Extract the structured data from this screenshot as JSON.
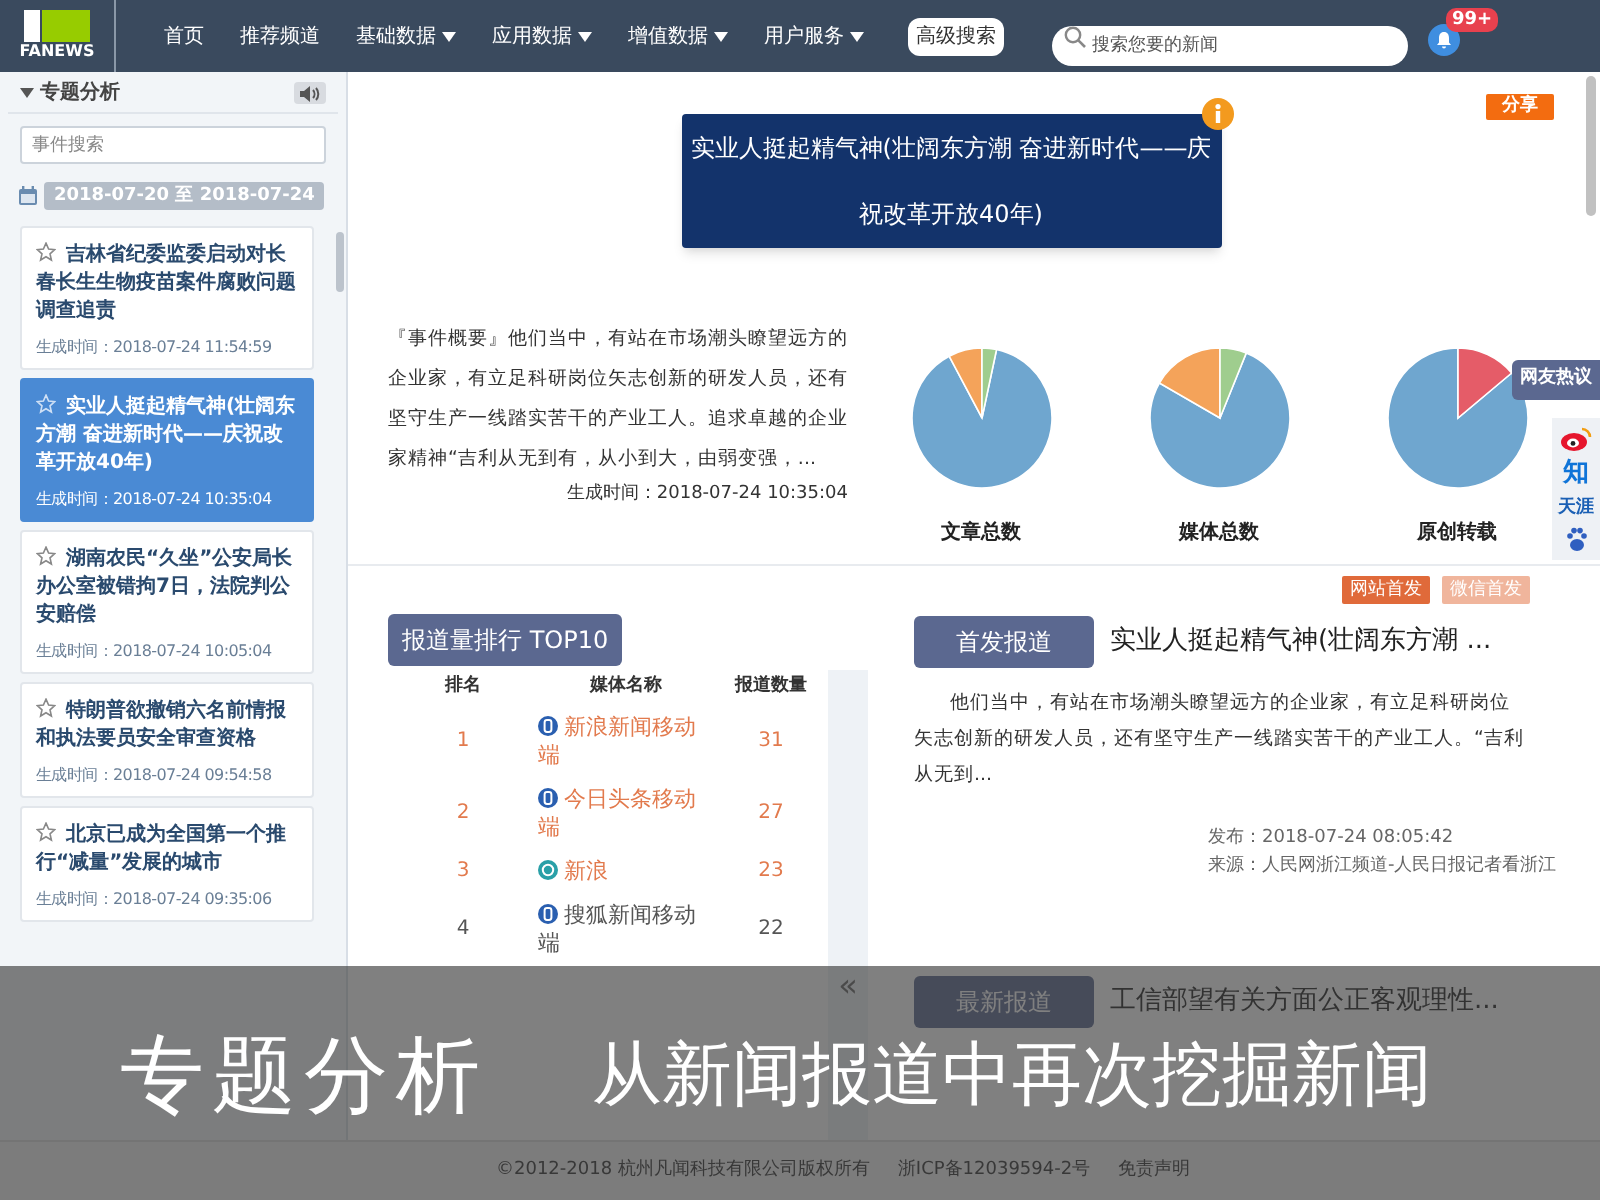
{
  "header": {
    "logo_text": "FANEWS",
    "nav": [
      {
        "label": "首页",
        "dropdown": false
      },
      {
        "label": "推荐频道",
        "dropdown": false
      },
      {
        "label": "基础数据",
        "dropdown": true
      },
      {
        "label": "应用数据",
        "dropdown": true
      },
      {
        "label": "增值数据",
        "dropdown": true
      },
      {
        "label": "用户服务",
        "dropdown": true
      }
    ],
    "advanced_search": "高级搜索",
    "search": {
      "placeholder": "搜索您要的新闻"
    },
    "notifications_badge": "99+"
  },
  "sidebar": {
    "title": "专题分析",
    "search": {
      "placeholder": "事件搜索"
    },
    "date_range": "2018-07-20 至 2018-07-24",
    "items": [
      {
        "title": "吉林省纪委监委启动对长春长生生物疫苗案件腐败问题调查追责",
        "time": "生成时间：2018-07-24 11:54:59",
        "selected": false
      },
      {
        "title": "实业人挺起精气神(壮阔东方潮 奋进新时代——庆祝改革开放40年)",
        "time": "生成时间：2018-07-24 10:35:04",
        "selected": true
      },
      {
        "title": "湖南农民“久坐”公安局长办公室被错拘7日，法院判公安赔偿",
        "time": "生成时间：2018-07-24 10:05:04",
        "selected": false
      },
      {
        "title": "特朗普欲撤销六名前情报和执法要员安全审查资格",
        "time": "生成时间：2018-07-24 09:54:58",
        "selected": false
      },
      {
        "title": "北京已成为全国第一个推行“减量”发展的城市",
        "time": "生成时间：2018-07-24 09:35:06",
        "selected": false
      }
    ]
  },
  "topic": {
    "title": "实业人挺起精气神(壮阔东方潮 奋进新时代——庆祝改革开放40年)",
    "share": "分享",
    "summary": "『事件概要』他们当中，有站在市场潮头瞭望远方的企业家，有立足科研岗位矢志创新的研发人员，还有坚守生产一线踏实苦干的产业工人。追求卓越的企业家精神“吉利从无到有，从小到大，由弱变强，...",
    "time": "生成时间：2018-07-24 10:35:04",
    "charts": [
      {
        "label": "文章总数"
      },
      {
        "label": "媒体总数"
      },
      {
        "label": "原创转载"
      }
    ]
  },
  "side_links": {
    "hot": "网友热议",
    "zhihu": "知",
    "tianya": "天涯"
  },
  "ranking": {
    "title": "报道量排行 TOP10",
    "columns": [
      "排名",
      "媒体名称",
      "报道数量"
    ],
    "rows": [
      {
        "rank": "1",
        "media": "新浪新闻移动端",
        "count": "31",
        "kind": "app",
        "highlighted": true
      },
      {
        "rank": "2",
        "media": "今日头条移动端",
        "count": "27",
        "kind": "app",
        "highlighted": true
      },
      {
        "rank": "3",
        "media": "新浪",
        "count": "23",
        "kind": "web",
        "highlighted": true
      },
      {
        "rank": "4",
        "media": "搜狐新闻移动端",
        "count": "22",
        "kind": "app",
        "highlighted": false
      }
    ],
    "collapse": "«"
  },
  "first_report": {
    "filters": [
      {
        "label": "网站首发",
        "selected": true
      },
      {
        "label": "微信首发",
        "selected": false
      }
    ],
    "tab": "首发报道",
    "title": "实业人挺起精气神(壮阔东方潮 ...",
    "text": "他们当中，有站在市场潮头瞭望远方的企业家，有立足科研岗位矢志创新的研发人员，还有坚守生产一线踏实苦干的产业工人。“吉利从无到...",
    "published": "发布：2018-07-24 08:05:42",
    "source": "来源：人民网浙江频道-人民日报记者看浙江"
  },
  "latest_report": {
    "tab": "最新报道",
    "title": "工信部望有关方面公正客观理性..."
  },
  "footer": [
    "©2012-2018 杭州凡闻科技有限公司版权所有",
    "浙ICP备12039594-2号",
    "免责声明"
  ],
  "caption": {
    "title": "专题分析",
    "subtitle": "从新闻报道中再次挖掘新闻"
  }
}
